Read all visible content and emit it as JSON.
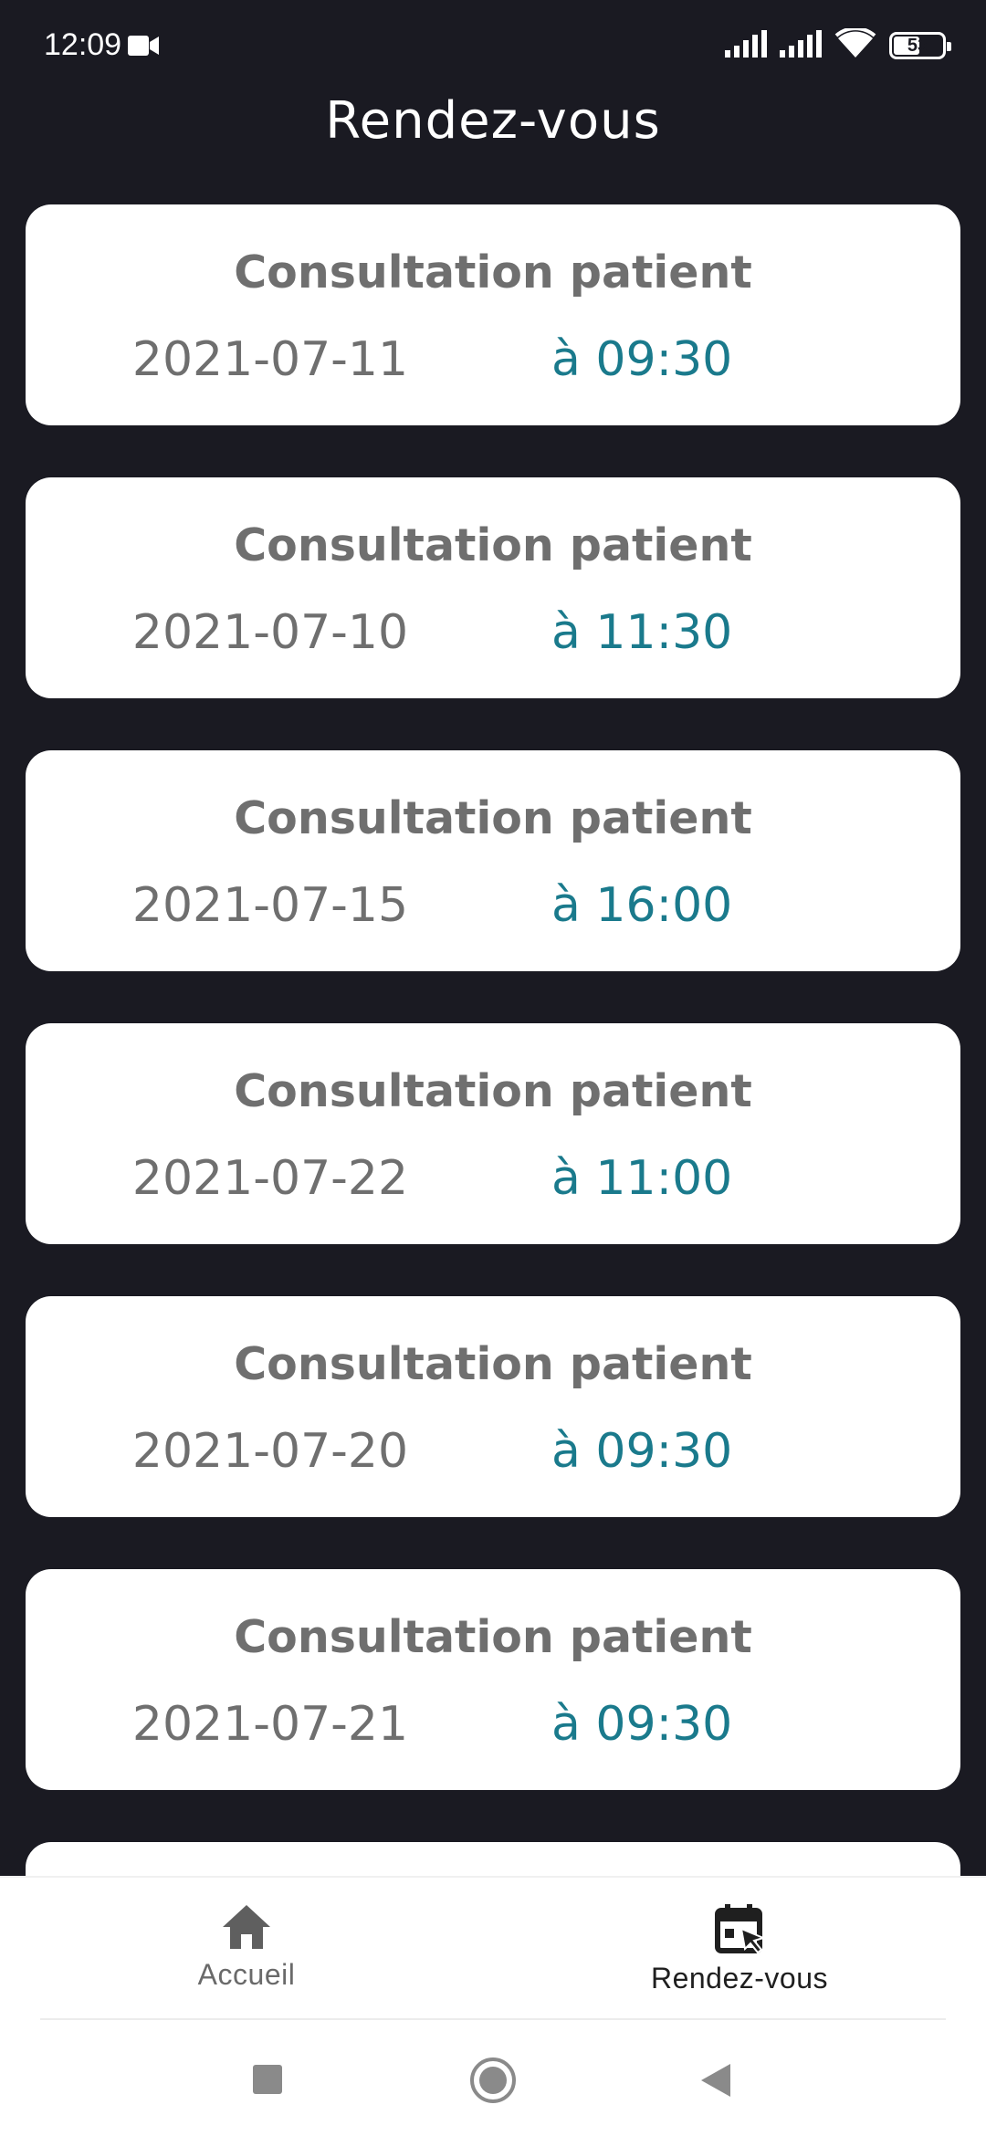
{
  "status_bar": {
    "time": "12:09",
    "battery": "53",
    "battery_level": 0.53,
    "icons": [
      "video-camera-icon",
      "signal-icon",
      "signal-icon",
      "wifi-icon",
      "battery-icon"
    ]
  },
  "header": {
    "title": "Rendez-vous"
  },
  "appointments": [
    {
      "title": "Consultation patient",
      "date": "2021-07-11",
      "time": "à 09:30"
    },
    {
      "title": "Consultation patient",
      "date": "2021-07-10",
      "time": "à 11:30"
    },
    {
      "title": "Consultation patient",
      "date": "2021-07-15",
      "time": "à 16:00"
    },
    {
      "title": "Consultation patient",
      "date": "2021-07-22",
      "time": "à 11:00"
    },
    {
      "title": "Consultation patient",
      "date": "2021-07-20",
      "time": "à 09:30"
    },
    {
      "title": "Consultation patient",
      "date": "2021-07-21",
      "time": "à 09:30"
    }
  ],
  "bottom_nav": {
    "items": [
      {
        "label": "Accueil",
        "icon": "home-icon",
        "active": false
      },
      {
        "label": "Rendez-vous",
        "icon": "calendar-icon",
        "active": true
      }
    ]
  },
  "system_nav": {
    "icons": [
      "recents-icon",
      "home-circle-icon",
      "back-icon"
    ]
  },
  "colors": {
    "background": "#1a1a22",
    "card": "#ffffff",
    "title_text": "#6f6f6f",
    "time_accent": "#1a7a8c"
  }
}
